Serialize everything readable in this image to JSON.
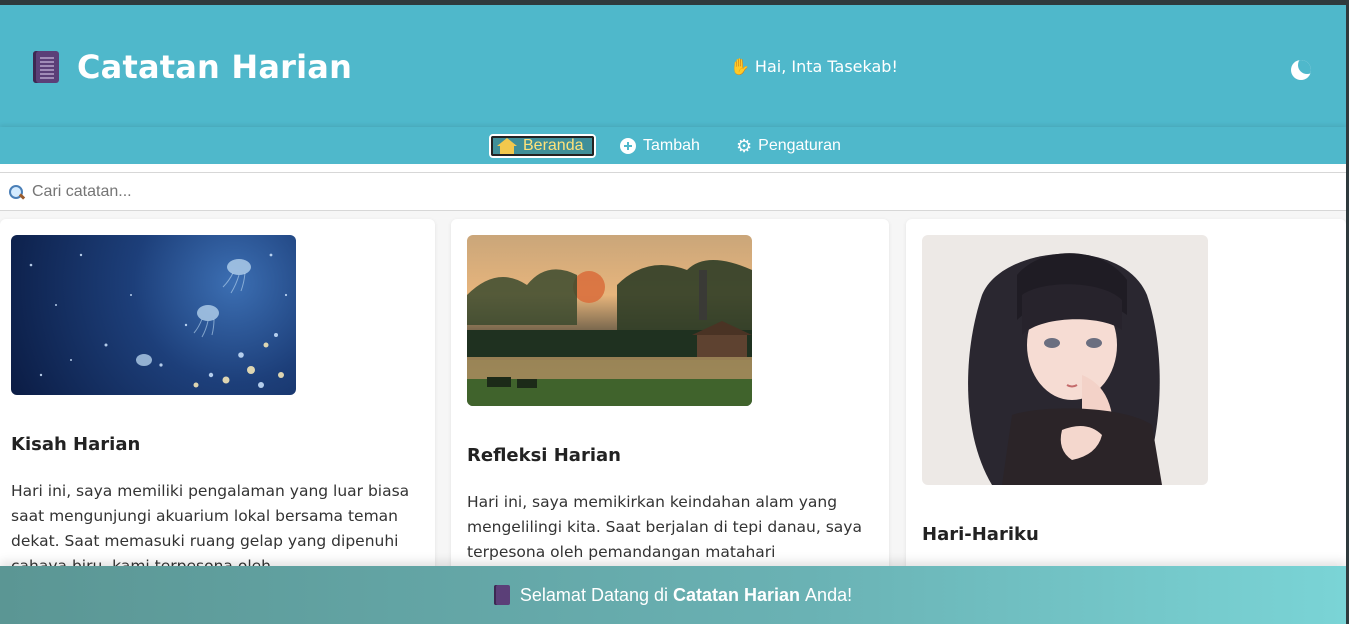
{
  "header": {
    "title": "Catatan Harian",
    "greeting": "Hai, Inta Tasekab!"
  },
  "nav": {
    "items": [
      {
        "label": "Beranda",
        "icon": "house-icon",
        "active": true
      },
      {
        "label": "Tambah",
        "icon": "plus-circle-icon",
        "active": false
      },
      {
        "label": "Pengaturan",
        "icon": "gear-icon",
        "active": false
      }
    ]
  },
  "search": {
    "placeholder": "Cari catatan...",
    "value": ""
  },
  "cards": [
    {
      "title": "Kisah Harian",
      "text": "Hari ini, saya memiliki pengalaman yang luar biasa saat mengunjungi akuarium lokal bersama teman dekat. Saat memasuki ruang gelap yang dipenuhi cahaya biru, kami terpesona oleh",
      "image": "jellyfish-image"
    },
    {
      "title": "Refleksi Harian",
      "text": "Hari ini, saya memikirkan keindahan alam yang mengelilingi kita. Saat berjalan di tepi danau, saya terpesona oleh pemandangan matahari",
      "image": "lake-sunset-image"
    },
    {
      "title": "Hari-Hariku",
      "text": "",
      "image": "anime-girl-image"
    }
  ],
  "footer": {
    "prefix": "Selamat Datang di",
    "brand": "Catatan Harian",
    "suffix": "Anda!"
  },
  "colors": {
    "primary": "#4fb8cb",
    "active_text": "#ffe27a",
    "footer_start": "#5b9694",
    "footer_end": "#7ad4d6"
  }
}
